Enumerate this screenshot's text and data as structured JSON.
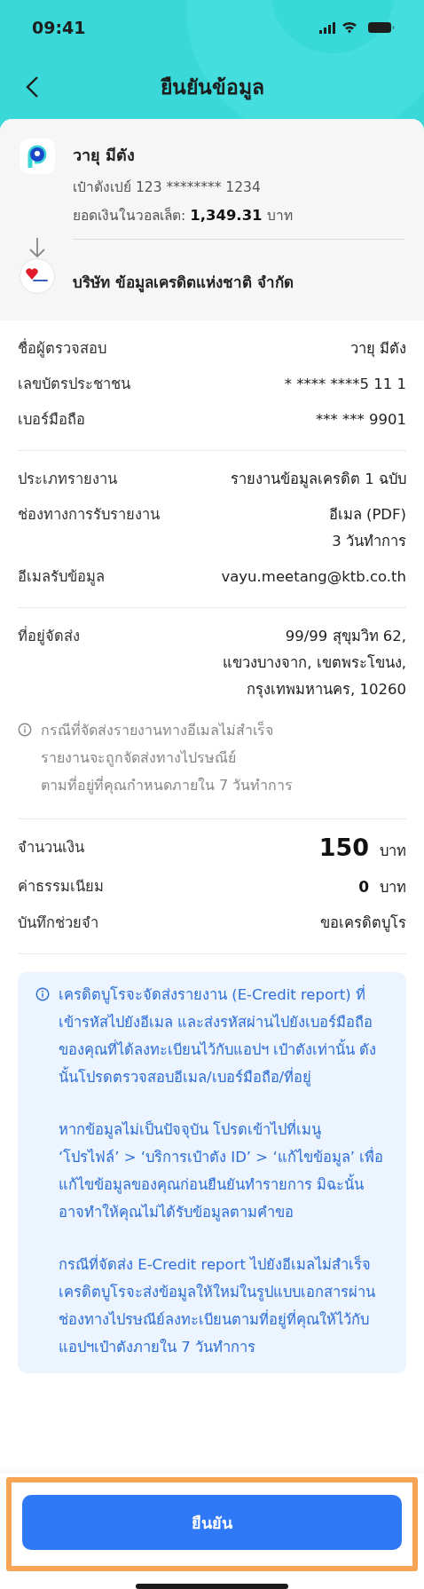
{
  "status_bar": {
    "time": "09:41"
  },
  "header": {
    "title": "ยืนยันข้อมูล"
  },
  "transfer": {
    "from": {
      "name": "วายุ มีตัง",
      "account": "เป๋าตังเปย์ 123 ******** 1234",
      "balance_label": "ยอดเงินในวอลเล็ต:",
      "balance_value": "1,349.31",
      "balance_unit": "บาท"
    },
    "to": {
      "name": "บริษัท ข้อมูลเครดิตแห่งชาติ จำกัด"
    }
  },
  "sections": [
    {
      "rows": [
        {
          "label": "ชื่อผู้ตรวจสอบ",
          "values": [
            "วายุ มีตัง"
          ]
        },
        {
          "label": "เลขบัตรประชาชน",
          "values": [
            "* **** ****5 11 1"
          ]
        },
        {
          "label": "เบอร์มือถือ",
          "values": [
            "*** *** 9901"
          ]
        }
      ]
    },
    {
      "rows": [
        {
          "label": "ประเภทรายงาน",
          "values": [
            "รายงานข้อมูลเครดิต 1 ฉบับ"
          ]
        },
        {
          "label": "ช่องทางการรับรายงาน",
          "values": [
            "อีเมล (PDF)",
            "3 วันทำการ"
          ]
        },
        {
          "label": "อีเมลรับข้อมูล",
          "values": [
            "vayu.meetang@ktb.co.th"
          ]
        }
      ]
    },
    {
      "rows": [
        {
          "label": "ที่อยู่จัดส่ง",
          "values": [
            "99/99 สุขุมวิท 62,",
            "แขวงบางจาก, เขตพระโขนง,",
            "กรุงเทพมหานคร, 10260"
          ]
        }
      ],
      "note": [
        "กรณีที่จัดส่งรายงานทางอีเมลไม่สำเร็จ",
        "รายงานจะถูกจัดส่งทางไปรษณีย์",
        "ตามที่อยู่ที่คุณกำหนดภายใน 7 วันทำการ"
      ]
    },
    {
      "rows": [
        {
          "label": "จำนวนเงิน",
          "kind": "amount",
          "amount": "150",
          "unit": "บาท"
        },
        {
          "label": "ค่าธรรมเนียม",
          "kind": "fee",
          "amount": "0",
          "unit": "บาท"
        },
        {
          "label": "บันทึกช่วยจำ",
          "values": [
            "ขอเครดิตบูโร"
          ]
        }
      ]
    }
  ],
  "info_box": [
    "เครดิตบูโรจะจัดส่งรายงาน (E-Credit report) ที่เข้ารหัสไปยังอีเมล และส่งรหัสผ่านไปยังเบอร์มือถือของคุณที่ได้ลงทะเบียนไว้กับแอปฯ เป๋าตังเท่านั้น ดังนั้นโปรดตรวจสอบอีเมล/เบอร์มือถือ/ที่อยู่",
    "หากข้อมูลไม่เป็นปัจจุบัน โปรดเข้าไปที่เมนู ‘โปรไฟล์’ > ‘บริการเป๋าตัง ID’ > ‘แก้ไขข้อมูล’ เพื่อแก้ไขข้อมูลของคุณก่อนยืนยันทำรายการ มิฉะนั้นอาจทำให้คุณไม่ได้รับข้อมูลตามคำขอ",
    "กรณีที่จัดส่ง E-Credit report ไปยังอีเมลไม่สำเร็จ เครดิตบูโรจะส่งข้อมูลให้ใหม่ในรูปแบบเอกสารผ่านช่องทางไปรษณีย์ลงทะเบียนตามที่อยู่ที่คุณให้ไว้กับแอปฯเป๋าตังภายใน 7 วันทำการ"
  ],
  "confirm_button": {
    "label": "ยืนยัน",
    "highlighted": true
  }
}
